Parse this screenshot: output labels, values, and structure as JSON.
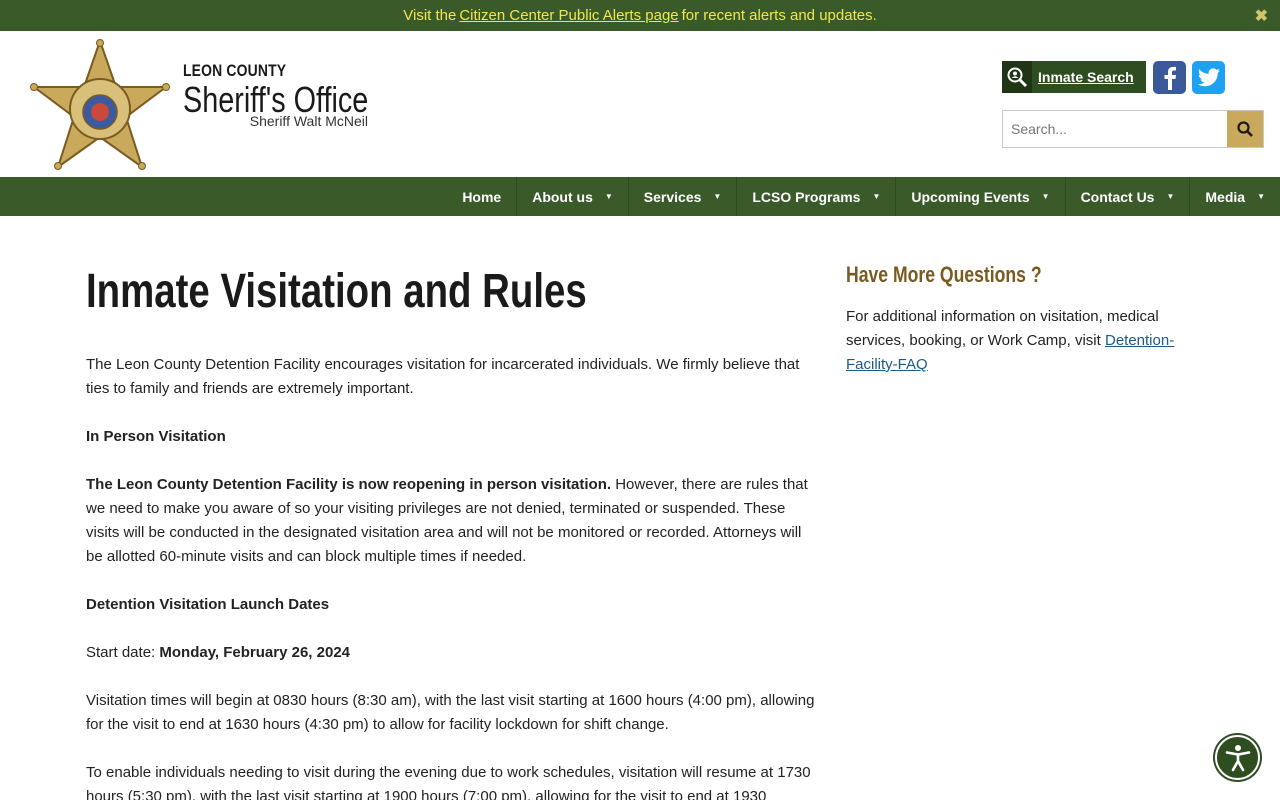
{
  "alert": {
    "prefix": "Visit the",
    "link_text": "Citizen Center Public Alerts page",
    "suffix": "for recent alerts and updates.",
    "close": "✖"
  },
  "header": {
    "county": "LEON COUNTY",
    "office": "Sheriff's Office",
    "sheriff": "Sheriff Walt McNeil",
    "inmate_search": "Inmate Search",
    "search_placeholder": "Search..."
  },
  "nav": {
    "items": [
      {
        "label": "Home",
        "has_caret": false
      },
      {
        "label": "About us",
        "has_caret": true
      },
      {
        "label": "Services",
        "has_caret": true
      },
      {
        "label": "LCSO Programs",
        "has_caret": true
      },
      {
        "label": "Upcoming Events",
        "has_caret": true
      },
      {
        "label": "Contact Us",
        "has_caret": true
      },
      {
        "label": "Media",
        "has_caret": true
      }
    ]
  },
  "main": {
    "title": "Inmate Visitation and Rules",
    "intro": "The Leon County Detention Facility encourages visitation for incarcerated individuals. We firmly believe that ties to family and friends are extremely important.",
    "in_person_heading": "In Person Visitation",
    "reopening_bold": "The Leon County Detention Facility is now reopening in person visitation.",
    "reopening_rest": " However, there are rules that we need to make you aware of so your visiting privileges are not denied, terminated or suspended. These visits will be conducted in the designated visitation area and will not be monitored or recorded. Attorneys will be allotted 60-minute visits and can block multiple times if needed.",
    "launch_heading": "Detention Visitation Launch Dates",
    "start_label": "Start date: ",
    "start_date": "Monday, February 26, 2024",
    "times_text": "Visitation times will begin at 0830 hours (8:30 am), with the last visit starting at 1600 hours (4:00 pm), allowing for the visit to end at 1630 hours (4:30 pm) to allow for facility lockdown for shift change.",
    "evening_text": "To enable individuals needing to visit during the evening due to work schedules, visitation will resume at 1730 hours (5:30 pm), with the last visit starting at 1900 hours (7:00 pm), allowing for the visit to end at 1930"
  },
  "sidebar": {
    "title": "Have More Questions ?",
    "text": "For additional information on visitation, medical services, booking, or Work Camp, visit ",
    "link": "Detention-Facility-FAQ"
  },
  "colors": {
    "green": "#3a5a2a",
    "gold": "#c9a95c",
    "alert_yellow": "#f2e64c",
    "sidebar_title": "#7a5a1e"
  }
}
